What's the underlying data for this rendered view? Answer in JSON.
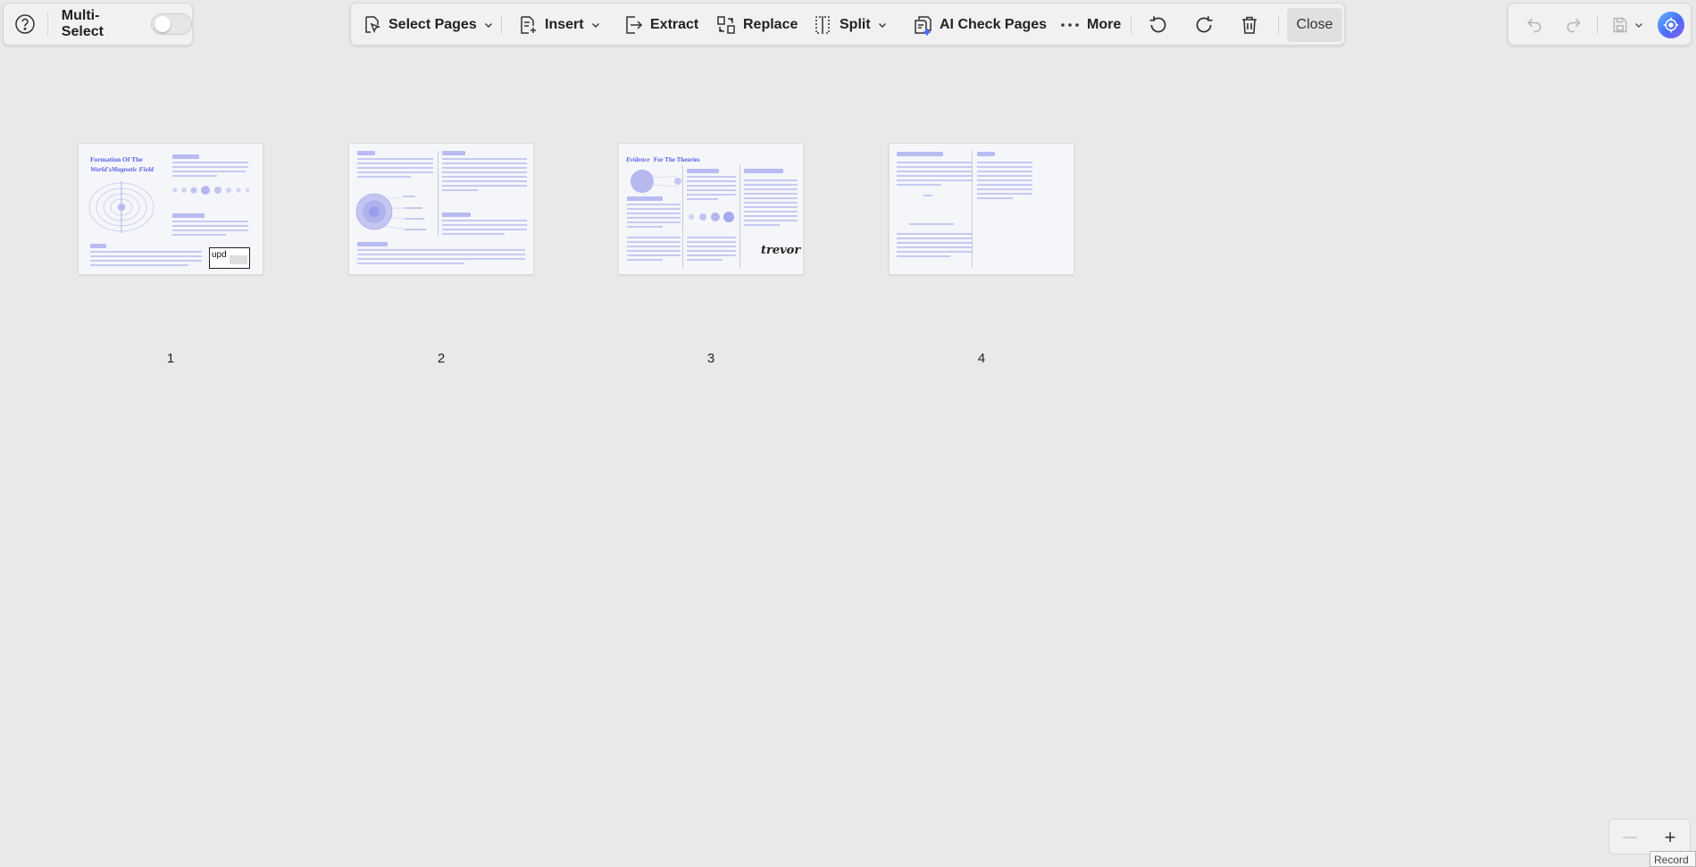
{
  "left_panel": {
    "help_icon": "question-circle-icon",
    "multi_select_label": "Multi-Select",
    "multi_select_enabled": false
  },
  "toolbar": {
    "select_pages": "Select Pages",
    "insert": "Insert",
    "extract": "Extract",
    "replace": "Replace",
    "split": "Split",
    "ai_check": "AI Check Pages",
    "more": "More",
    "close": "Close",
    "icons": [
      "select-pages-icon",
      "insert-icon",
      "extract-icon",
      "replace-icon",
      "split-icon",
      "ai-check-icon",
      "more-dots-icon",
      "rotate-left-icon",
      "rotate-right-icon",
      "trash-icon"
    ]
  },
  "right_panel": {
    "icons": [
      "undo-icon",
      "redo-icon",
      "save-icon",
      "chevron-down-icon",
      "ai-assistant-icon"
    ]
  },
  "pages": [
    {
      "number": "1",
      "title_line1": "Formation Of The",
      "title_line2": "World'sMagnetic Field",
      "stamp_text": "upd"
    },
    {
      "number": "2"
    },
    {
      "number": "3",
      "title_a": "Evidence",
      "title_b": "For The Theories",
      "signature": "trevor"
    },
    {
      "number": "4"
    }
  ],
  "zoom": {
    "minus": "—",
    "plus": "+",
    "tooltip": "Record"
  },
  "colors": {
    "accent": "#5a5ee8",
    "background": "#e9e9e9",
    "panel": "#f1f1f1"
  }
}
